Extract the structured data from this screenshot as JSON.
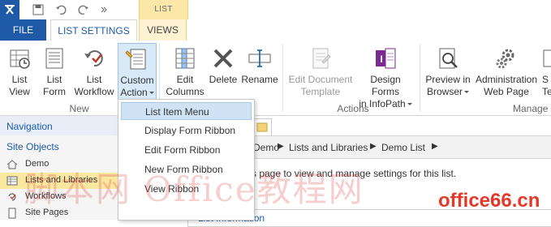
{
  "tabs": {
    "file": "FILE",
    "list_settings": "LIST SETTINGS",
    "context_label": "LIST",
    "views": "VIEWS"
  },
  "ribbon": {
    "buttons": [
      {
        "label1": "List",
        "label2": "View"
      },
      {
        "label1": "List",
        "label2": "Form"
      },
      {
        "label1": "List",
        "label2": "Workflow"
      },
      {
        "label1": "Custom",
        "label2": "Action"
      },
      {
        "label1": "Edit",
        "label2": "Columns"
      },
      {
        "label1": "Delete",
        "label2": ""
      },
      {
        "label1": "Rename",
        "label2": ""
      },
      {
        "label1": "Edit Document",
        "label2": "Template"
      },
      {
        "label1": "Design Forms",
        "label2": "in InfoPath"
      },
      {
        "label1": "Preview in",
        "label2": "Browser"
      },
      {
        "label1": "Administration",
        "label2": "Web Page"
      },
      {
        "label1": "S",
        "label2": "Te"
      }
    ],
    "groups": {
      "new": "New",
      "actions": "Actions",
      "manage": "Manage"
    }
  },
  "menu": {
    "items": [
      "List Item Menu",
      "Display Form Ribbon",
      "Edit Form Ribbon",
      "New Form Ribbon",
      "View Ribbon"
    ]
  },
  "leftnav": {
    "title": "Navigation",
    "site_objects": "Site Objects",
    "items": [
      "Demo",
      "Lists and Libraries",
      "Workflows",
      "Site Pages"
    ]
  },
  "breadcrumb": [
    "Demo",
    "Lists and Libraries",
    "Demo List"
  ],
  "main": {
    "description": "s page to view and manage settings for this list.",
    "info_title": "List Information"
  },
  "watermark": {
    "cn": "脚本网 Office教程网",
    "site": "office66.cn"
  },
  "colors": {
    "accent": "#1e5aa8",
    "context": "#fbe8a8",
    "highlight": "#fbe8a0"
  }
}
